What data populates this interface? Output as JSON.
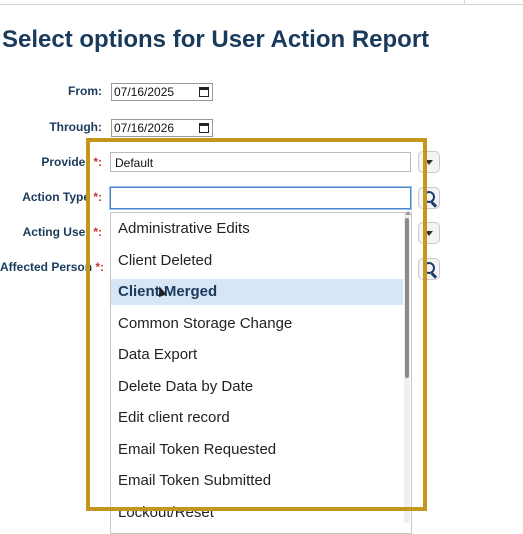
{
  "page": {
    "title": "Select options for User Action Report"
  },
  "form": {
    "from_label": "From:",
    "from_value": "07/16/2025",
    "through_label": "Through:",
    "through_value": "07/16/2026",
    "provider_label": "Provider",
    "provider_value": "Default",
    "action_type_label": "Action Type",
    "action_type_value": "",
    "acting_user_label": "Acting User",
    "affected_person_label": "Affected Person",
    "required_marker": " *:"
  },
  "dropdown": {
    "options": [
      "Administrative Edits",
      "Client Deleted",
      "Client Merged",
      "Common Storage Change",
      "Data Export",
      "Delete Data by Date",
      "Edit client record",
      "Email Token Requested",
      "Email Token Submitted",
      "Lockout/Reset"
    ],
    "highlighted": "Client Merged"
  },
  "colors": {
    "title": "#1a3a5c",
    "required": "#c0392b",
    "highlight_frame": "#c4961c",
    "hover_row": "#d6e6f7"
  },
  "icons": {
    "date_picker": "calendar-icon",
    "provider_toggle": "chevron-down-icon",
    "action_type_search": "search-icon",
    "acting_user_toggle": "chevron-down-icon",
    "affected_person_search": "search-icon"
  }
}
